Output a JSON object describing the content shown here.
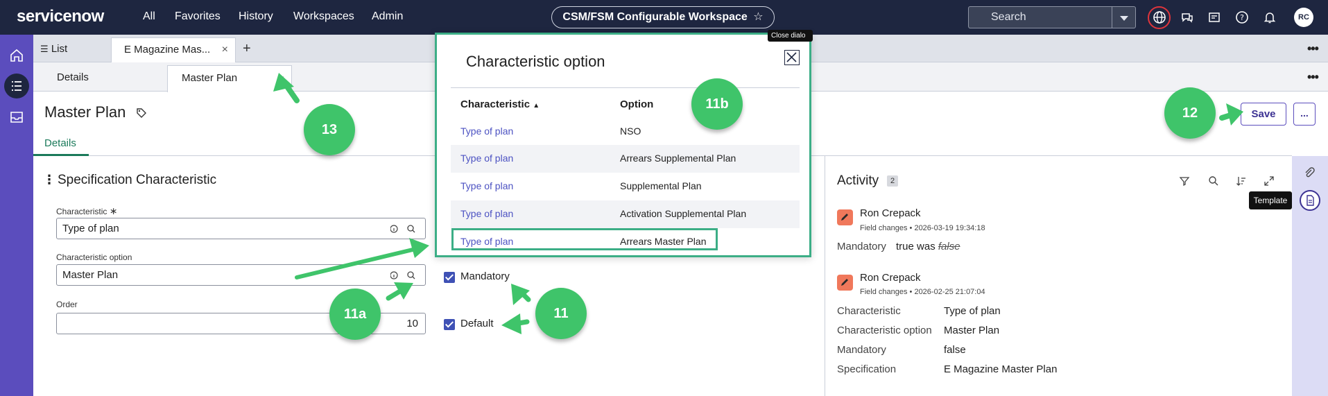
{
  "header": {
    "logo": "servicenow",
    "nav": [
      "All",
      "Favorites",
      "History",
      "Workspaces",
      "Admin"
    ],
    "workspace": "CSM/FSM Configurable Workspace",
    "search_placeholder": "Search",
    "avatar_initials": "RC"
  },
  "tabs": {
    "list_label": "List",
    "record_tab": "E Magazine Mas...",
    "close_glyph": "×",
    "add_glyph": "+"
  },
  "subtabs": {
    "details": "Details",
    "master_plan": "Master Plan"
  },
  "page": {
    "title": "Master Plan",
    "details_tab": "Details",
    "save": "Save",
    "more": "..."
  },
  "form": {
    "section_title": "Specification Characteristic",
    "characteristic_label": "Characteristic",
    "characteristic_value": "Type of plan",
    "option_label": "Characteristic option",
    "option_value": "Master Plan",
    "order_label": "Order",
    "order_value": "10",
    "mandatory_label": "Mandatory",
    "default_label": "Default",
    "required_marker": "∗"
  },
  "activity": {
    "title": "Activity",
    "count": "2",
    "entries": [
      {
        "author": "Ron Crepack",
        "meta": "Field changes • 2026-03-19 19:34:18",
        "change_key": "Mandatory",
        "change_new": "true was",
        "change_old": "false"
      },
      {
        "author": "Ron Crepack",
        "meta": "Field changes • 2026-02-25 21:07:04",
        "rows": [
          {
            "k": "Characteristic",
            "v": "Type of plan"
          },
          {
            "k": "Characteristic option",
            "v": "Master Plan"
          },
          {
            "k": "Mandatory",
            "v": "false"
          },
          {
            "k": "Specification",
            "v": "E Magazine Master Plan"
          }
        ]
      }
    ]
  },
  "sidepanel": {
    "tooltip": "Template"
  },
  "modal": {
    "title": "Characteristic option",
    "close_tip": "Close dialo",
    "col_characteristic": "Characteristic",
    "col_option": "Option",
    "rows": [
      {
        "characteristic": "Type of plan",
        "option": "NSO"
      },
      {
        "characteristic": "Type of plan",
        "option": "Arrears Supplemental Plan"
      },
      {
        "characteristic": "Type of plan",
        "option": "Supplemental Plan"
      },
      {
        "characteristic": "Type of plan",
        "option": "Activation Supplemental Plan"
      },
      {
        "characteristic": "Type of plan",
        "option": "Arrears Master Plan"
      }
    ]
  },
  "callouts": {
    "c11a": "11a",
    "c11b": "11b",
    "c11": "11",
    "c12": "12",
    "c13": "13"
  },
  "colors": {
    "topbar": "#1e2640",
    "rail": "#5b4dbd",
    "callout": "#3fc46a",
    "highlight": "#3cae86",
    "link": "#4c52c2"
  }
}
